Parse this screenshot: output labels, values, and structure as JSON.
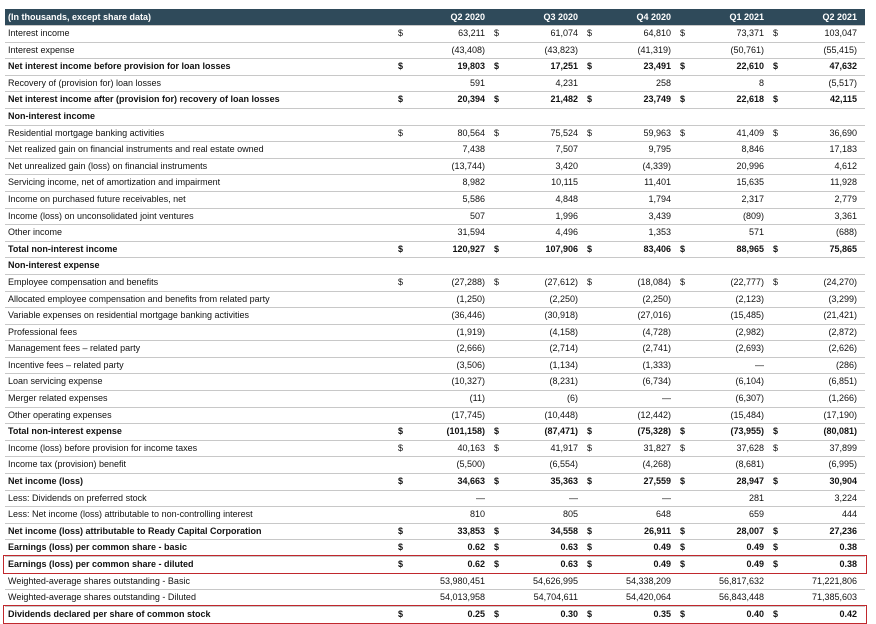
{
  "header": {
    "label": "(In thousands, except share data)",
    "columns": [
      "Q2 2020",
      "Q3 2020",
      "Q4 2020",
      "Q1 2021",
      "Q2 2021"
    ]
  },
  "rows": [
    {
      "label": "Interest income",
      "leadDollar": "$",
      "values": [
        {
          "v": "63,211",
          "d": "$"
        },
        {
          "v": "61,074",
          "d": "$"
        },
        {
          "v": "64,810",
          "d": "$"
        },
        {
          "v": "73,371",
          "d": "$"
        },
        {
          "v": "103,047",
          "d": ""
        }
      ]
    },
    {
      "label": "Interest expense",
      "leadDollar": "",
      "values": [
        {
          "v": "(43,408)",
          "d": ""
        },
        {
          "v": "(43,823)",
          "d": ""
        },
        {
          "v": "(41,319)",
          "d": ""
        },
        {
          "v": "(50,761)",
          "d": ""
        },
        {
          "v": "(55,415)",
          "d": ""
        }
      ]
    },
    {
      "label": "Net interest income before provision for loan losses",
      "leadDollar": "$",
      "bold": true,
      "values": [
        {
          "v": "19,803",
          "d": "$"
        },
        {
          "v": "17,251",
          "d": "$"
        },
        {
          "v": "23,491",
          "d": "$"
        },
        {
          "v": "22,610",
          "d": "$"
        },
        {
          "v": "47,632",
          "d": ""
        }
      ]
    },
    {
      "label": "Recovery of (provision for) loan losses",
      "leadDollar": "",
      "values": [
        {
          "v": "591",
          "d": ""
        },
        {
          "v": "4,231",
          "d": ""
        },
        {
          "v": "258",
          "d": ""
        },
        {
          "v": "8",
          "d": ""
        },
        {
          "v": "(5,517)",
          "d": ""
        }
      ]
    },
    {
      "label": "Net interest income after (provision for) recovery of loan losses",
      "leadDollar": "$",
      "bold": true,
      "values": [
        {
          "v": "20,394",
          "d": "$"
        },
        {
          "v": "21,482",
          "d": "$"
        },
        {
          "v": "23,749",
          "d": "$"
        },
        {
          "v": "22,618",
          "d": "$"
        },
        {
          "v": "42,115",
          "d": ""
        }
      ]
    },
    {
      "label": "Non-interest income",
      "leadDollar": "",
      "bold": true,
      "values": []
    },
    {
      "label": "Residential mortgage banking activities",
      "leadDollar": "$",
      "values": [
        {
          "v": "80,564",
          "d": "$"
        },
        {
          "v": "75,524",
          "d": "$"
        },
        {
          "v": "59,963",
          "d": "$"
        },
        {
          "v": "41,409",
          "d": "$"
        },
        {
          "v": "36,690",
          "d": ""
        }
      ]
    },
    {
      "label": "Net realized gain on financial instruments and real estate owned",
      "leadDollar": "",
      "values": [
        {
          "v": "7,438",
          "d": ""
        },
        {
          "v": "7,507",
          "d": ""
        },
        {
          "v": "9,795",
          "d": ""
        },
        {
          "v": "8,846",
          "d": ""
        },
        {
          "v": "17,183",
          "d": ""
        }
      ]
    },
    {
      "label": "Net unrealized gain (loss) on financial instruments",
      "leadDollar": "",
      "values": [
        {
          "v": "(13,744)",
          "d": ""
        },
        {
          "v": "3,420",
          "d": ""
        },
        {
          "v": "(4,339)",
          "d": ""
        },
        {
          "v": "20,996",
          "d": ""
        },
        {
          "v": "4,612",
          "d": ""
        }
      ]
    },
    {
      "label": "Servicing income, net of amortization and impairment",
      "leadDollar": "",
      "values": [
        {
          "v": "8,982",
          "d": ""
        },
        {
          "v": "10,115",
          "d": ""
        },
        {
          "v": "11,401",
          "d": ""
        },
        {
          "v": "15,635",
          "d": ""
        },
        {
          "v": "11,928",
          "d": ""
        }
      ]
    },
    {
      "label": "Income on purchased future receivables, net",
      "leadDollar": "",
      "values": [
        {
          "v": "5,586",
          "d": ""
        },
        {
          "v": "4,848",
          "d": ""
        },
        {
          "v": "1,794",
          "d": ""
        },
        {
          "v": "2,317",
          "d": ""
        },
        {
          "v": "2,779",
          "d": ""
        }
      ]
    },
    {
      "label": "Income (loss) on unconsolidated joint ventures",
      "leadDollar": "",
      "values": [
        {
          "v": "507",
          "d": ""
        },
        {
          "v": "1,996",
          "d": ""
        },
        {
          "v": "3,439",
          "d": ""
        },
        {
          "v": "(809)",
          "d": ""
        },
        {
          "v": "3,361",
          "d": ""
        }
      ]
    },
    {
      "label": "Other income",
      "leadDollar": "",
      "values": [
        {
          "v": "31,594",
          "d": ""
        },
        {
          "v": "4,496",
          "d": ""
        },
        {
          "v": "1,353",
          "d": ""
        },
        {
          "v": "571",
          "d": ""
        },
        {
          "v": "(688)",
          "d": ""
        }
      ]
    },
    {
      "label": "Total non-interest income",
      "leadDollar": "$",
      "bold": true,
      "values": [
        {
          "v": "120,927",
          "d": "$"
        },
        {
          "v": "107,906",
          "d": "$"
        },
        {
          "v": "83,406",
          "d": "$"
        },
        {
          "v": "88,965",
          "d": "$"
        },
        {
          "v": "75,865",
          "d": ""
        }
      ]
    },
    {
      "label": "Non-interest expense",
      "leadDollar": "",
      "bold": true,
      "values": []
    },
    {
      "label": "Employee compensation and benefits",
      "leadDollar": "$",
      "values": [
        {
          "v": "(27,288)",
          "d": "$"
        },
        {
          "v": "(27,612)",
          "d": "$"
        },
        {
          "v": "(18,084)",
          "d": "$"
        },
        {
          "v": "(22,777)",
          "d": "$"
        },
        {
          "v": "(24,270)",
          "d": ""
        }
      ]
    },
    {
      "label": "Allocated employee compensation and benefits from related party",
      "leadDollar": "",
      "values": [
        {
          "v": "(1,250)",
          "d": ""
        },
        {
          "v": "(2,250)",
          "d": ""
        },
        {
          "v": "(2,250)",
          "d": ""
        },
        {
          "v": "(2,123)",
          "d": ""
        },
        {
          "v": "(3,299)",
          "d": ""
        }
      ]
    },
    {
      "label": "Variable expenses on residential mortgage banking activities",
      "leadDollar": "",
      "values": [
        {
          "v": "(36,446)",
          "d": ""
        },
        {
          "v": "(30,918)",
          "d": ""
        },
        {
          "v": "(27,016)",
          "d": ""
        },
        {
          "v": "(15,485)",
          "d": ""
        },
        {
          "v": "(21,421)",
          "d": ""
        }
      ]
    },
    {
      "label": "Professional fees",
      "leadDollar": "",
      "values": [
        {
          "v": "(1,919)",
          "d": ""
        },
        {
          "v": "(4,158)",
          "d": ""
        },
        {
          "v": "(4,728)",
          "d": ""
        },
        {
          "v": "(2,982)",
          "d": ""
        },
        {
          "v": "(2,872)",
          "d": ""
        }
      ]
    },
    {
      "label": "Management fees – related party",
      "leadDollar": "",
      "values": [
        {
          "v": "(2,666)",
          "d": ""
        },
        {
          "v": "(2,714)",
          "d": ""
        },
        {
          "v": "(2,741)",
          "d": ""
        },
        {
          "v": "(2,693)",
          "d": ""
        },
        {
          "v": "(2,626)",
          "d": ""
        }
      ]
    },
    {
      "label": "Incentive fees – related party",
      "leadDollar": "",
      "values": [
        {
          "v": "(3,506)",
          "d": ""
        },
        {
          "v": "(1,134)",
          "d": ""
        },
        {
          "v": "(1,333)",
          "d": ""
        },
        {
          "v": "—",
          "d": ""
        },
        {
          "v": "(286)",
          "d": ""
        }
      ]
    },
    {
      "label": "Loan servicing expense",
      "leadDollar": "",
      "values": [
        {
          "v": "(10,327)",
          "d": ""
        },
        {
          "v": "(8,231)",
          "d": ""
        },
        {
          "v": "(6,734)",
          "d": ""
        },
        {
          "v": "(6,104)",
          "d": ""
        },
        {
          "v": "(6,851)",
          "d": ""
        }
      ]
    },
    {
      "label": "Merger related expenses",
      "leadDollar": "",
      "values": [
        {
          "v": "(11)",
          "d": ""
        },
        {
          "v": "(6)",
          "d": ""
        },
        {
          "v": "—",
          "d": ""
        },
        {
          "v": "(6,307)",
          "d": ""
        },
        {
          "v": "(1,266)",
          "d": ""
        }
      ]
    },
    {
      "label": "Other operating expenses",
      "leadDollar": "",
      "values": [
        {
          "v": "(17,745)",
          "d": ""
        },
        {
          "v": "(10,448)",
          "d": ""
        },
        {
          "v": "(12,442)",
          "d": ""
        },
        {
          "v": "(15,484)",
          "d": ""
        },
        {
          "v": "(17,190)",
          "d": ""
        }
      ]
    },
    {
      "label": "Total non-interest expense",
      "leadDollar": "$",
      "bold": true,
      "values": [
        {
          "v": "(101,158)",
          "d": "$"
        },
        {
          "v": "(87,471)",
          "d": "$"
        },
        {
          "v": "(75,328)",
          "d": "$"
        },
        {
          "v": "(73,955)",
          "d": "$"
        },
        {
          "v": "(80,081)",
          "d": ""
        }
      ]
    },
    {
      "label": "Income (loss) before provision for income taxes",
      "leadDollar": "$",
      "values": [
        {
          "v": "40,163",
          "d": "$"
        },
        {
          "v": "41,917",
          "d": "$"
        },
        {
          "v": "31,827",
          "d": "$"
        },
        {
          "v": "37,628",
          "d": "$"
        },
        {
          "v": "37,899",
          "d": ""
        }
      ]
    },
    {
      "label": "Income tax (provision) benefit",
      "leadDollar": "",
      "values": [
        {
          "v": "(5,500)",
          "d": ""
        },
        {
          "v": "(6,554)",
          "d": ""
        },
        {
          "v": "(4,268)",
          "d": ""
        },
        {
          "v": "(8,681)",
          "d": ""
        },
        {
          "v": "(6,995)",
          "d": ""
        }
      ]
    },
    {
      "label": "Net income (loss)",
      "leadDollar": "$",
      "bold": true,
      "values": [
        {
          "v": "34,663",
          "d": "$"
        },
        {
          "v": "35,363",
          "d": "$"
        },
        {
          "v": "27,559",
          "d": "$"
        },
        {
          "v": "28,947",
          "d": "$"
        },
        {
          "v": "30,904",
          "d": ""
        }
      ]
    },
    {
      "label": "Less: Dividends on preferred stock",
      "leadDollar": "",
      "values": [
        {
          "v": "—",
          "d": ""
        },
        {
          "v": "—",
          "d": ""
        },
        {
          "v": "—",
          "d": ""
        },
        {
          "v": "281",
          "d": ""
        },
        {
          "v": "3,224",
          "d": ""
        }
      ]
    },
    {
      "label": "Less: Net income (loss) attributable to non-controlling interest",
      "leadDollar": "",
      "values": [
        {
          "v": "810",
          "d": ""
        },
        {
          "v": "805",
          "d": ""
        },
        {
          "v": "648",
          "d": ""
        },
        {
          "v": "659",
          "d": ""
        },
        {
          "v": "444",
          "d": ""
        }
      ]
    },
    {
      "label": "Net income (loss) attributable to Ready Capital Corporation",
      "leadDollar": "$",
      "bold": true,
      "values": [
        {
          "v": "33,853",
          "d": "$"
        },
        {
          "v": "34,558",
          "d": "$"
        },
        {
          "v": "26,911",
          "d": "$"
        },
        {
          "v": "28,007",
          "d": "$"
        },
        {
          "v": "27,236",
          "d": ""
        }
      ]
    },
    {
      "label": "Earnings (loss) per common share - basic",
      "leadDollar": "$",
      "bold": true,
      "values": [
        {
          "v": "0.62",
          "d": "$"
        },
        {
          "v": "0.63",
          "d": "$"
        },
        {
          "v": "0.49",
          "d": "$"
        },
        {
          "v": "0.49",
          "d": "$"
        },
        {
          "v": "0.38",
          "d": ""
        }
      ]
    },
    {
      "label": "Earnings (loss) per common share - diluted",
      "leadDollar": "$",
      "bold": true,
      "values": [
        {
          "v": "0.62",
          "d": "$"
        },
        {
          "v": "0.63",
          "d": "$"
        },
        {
          "v": "0.49",
          "d": "$"
        },
        {
          "v": "0.49",
          "d": "$"
        },
        {
          "v": "0.38",
          "d": ""
        }
      ]
    },
    {
      "label": "Weighted-average shares outstanding - Basic",
      "leadDollar": "",
      "values": [
        {
          "v": "53,980,451",
          "d": ""
        },
        {
          "v": "54,626,995",
          "d": ""
        },
        {
          "v": "54,338,209",
          "d": ""
        },
        {
          "v": "56,817,632",
          "d": ""
        },
        {
          "v": "71,221,806",
          "d": ""
        }
      ]
    },
    {
      "label": "Weighted-average shares outstanding - Diluted",
      "leadDollar": "",
      "values": [
        {
          "v": "54,013,958",
          "d": ""
        },
        {
          "v": "54,704,611",
          "d": ""
        },
        {
          "v": "54,420,064",
          "d": ""
        },
        {
          "v": "56,843,448",
          "d": ""
        },
        {
          "v": "71,385,603",
          "d": ""
        }
      ]
    },
    {
      "label": "Dividends declared per share of common stock",
      "leadDollar": "$",
      "bold": true,
      "values": [
        {
          "v": "0.25",
          "d": "$"
        },
        {
          "v": "0.30",
          "d": "$"
        },
        {
          "v": "0.35",
          "d": "$"
        },
        {
          "v": "0.40",
          "d": "$"
        },
        {
          "v": "0.42",
          "d": ""
        }
      ]
    }
  ],
  "highlights": [
    "Earnings (loss) per common share - diluted",
    "Dividends declared per share of common stock"
  ],
  "colors": {
    "header_bg": "#2f4a5a",
    "header_text": "#ffffff",
    "highlight_border": "#c0282d"
  }
}
